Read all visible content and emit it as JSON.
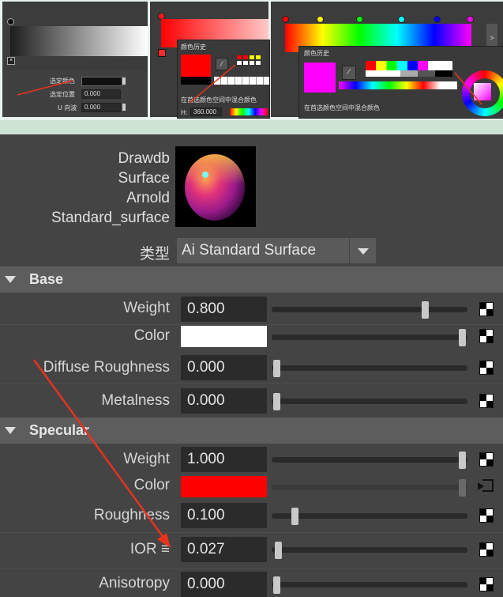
{
  "collage": {
    "left": {
      "rows": [
        {
          "label": "选定颜色",
          "value": ""
        },
        {
          "label": "选定位置",
          "value": "0.000"
        },
        {
          "label": "U 向波",
          "value": "0.000"
        }
      ]
    },
    "middle": {
      "history_title": "颜色历史",
      "mix_text": "在首选颜色空间中混合颜色",
      "h_label": "H:",
      "h_value": "360.000"
    },
    "right": {
      "history_title": "颜色历史",
      "mix_text": "在首选颜色空间中混合颜色",
      "scroll_label": ">"
    }
  },
  "node": {
    "names": [
      "Drawdb",
      "Surface",
      "Arnold",
      "Standard_surface"
    ],
    "type_label": "类型",
    "type_value": "Ai Standard Surface"
  },
  "sections": [
    {
      "title": "Base",
      "rows": [
        {
          "label": "Weight",
          "value": "0.800",
          "slider": 0.8
        },
        {
          "label": "Color",
          "value": "",
          "color": "#ffffff",
          "slider": 1.0
        },
        {
          "label": "Diffuse Roughness",
          "value": "0.000",
          "slider": 0.0
        },
        {
          "label": "Metalness",
          "value": "0.000",
          "slider": 0.0
        }
      ]
    },
    {
      "title": "Specular",
      "rows": [
        {
          "label": "Weight",
          "value": "1.000",
          "slider": 1.0
        },
        {
          "label": "Color",
          "value": "",
          "color": "#ff0000",
          "slider": 1.0
        },
        {
          "label": "Roughness",
          "value": "0.100",
          "slider": 0.1
        },
        {
          "label": "IOR ≡",
          "value": "0.027",
          "slider": 0.0
        },
        {
          "label": "Anisotropy",
          "value": "0.000",
          "slider": 0.0
        }
      ]
    }
  ],
  "annotation_color": "#e8321e"
}
